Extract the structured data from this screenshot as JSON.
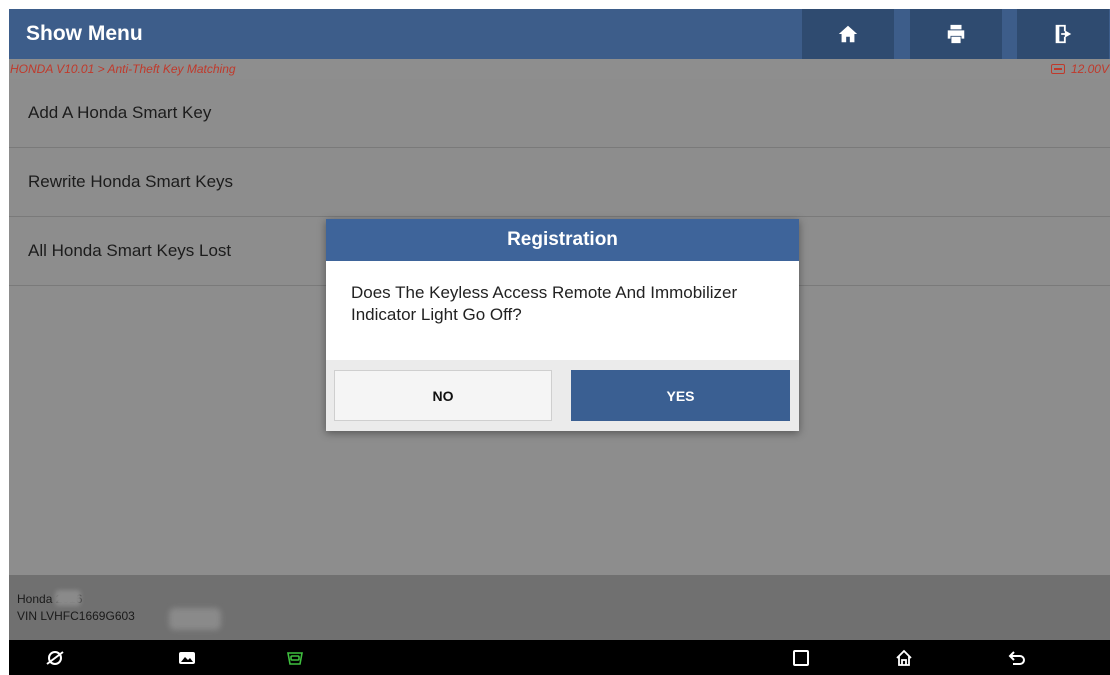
{
  "header": {
    "title": "Show Menu",
    "icons": [
      "home-icon",
      "print-icon",
      "exit-icon"
    ],
    "color": "#3d5d8a"
  },
  "subbar": {
    "breadcrumb": "HONDA V10.01 > Anti-Theft Key Matching",
    "voltage": "12.00V"
  },
  "menu": {
    "items": [
      {
        "label": "Add A Honda Smart Key"
      },
      {
        "label": "Rewrite Honda Smart Keys"
      },
      {
        "label": "All Honda Smart Keys Lost"
      }
    ]
  },
  "footer": {
    "vehicle": "Honda        2016",
    "vin": "VIN LVHFC1669G603"
  },
  "dialog": {
    "title": "Registration",
    "message": "Does The Keyless Access Remote And Immobilizer Indicator Light Go Off?",
    "no_label": "NO",
    "yes_label": "YES",
    "accent": "#3e649a"
  },
  "navbar": {
    "icons": [
      "browser-icon",
      "gallery-icon",
      "vci-icon",
      "recent-apps-icon",
      "android-home-icon",
      "back-icon"
    ]
  }
}
